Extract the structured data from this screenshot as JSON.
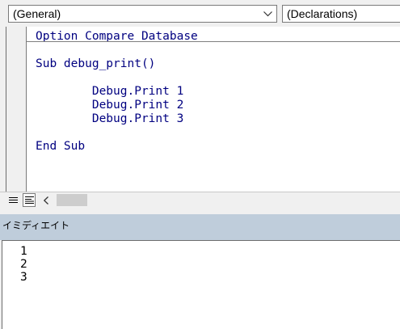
{
  "dropdowns": {
    "object": {
      "value": "(General)",
      "icon": "chevron-down-icon"
    },
    "procedure": {
      "value": "(Declarations)"
    }
  },
  "code": {
    "lines": [
      "Option Compare Database",
      "Sub debug_print()",
      "        Debug.Print 1",
      "        Debug.Print 2",
      "        Debug.Print 3",
      "End Sub"
    ],
    "text_color": "#000080"
  },
  "toolbar": {
    "procedure_view_icon": "procedure-view-icon",
    "full_module_view_icon": "full-module-view-icon",
    "scroll_left_icon": "scroll-left-arrow-icon"
  },
  "immediate": {
    "title": "イミディエイト",
    "title_bg": "#bfcddb",
    "output": [
      "1",
      "2",
      "3"
    ]
  }
}
